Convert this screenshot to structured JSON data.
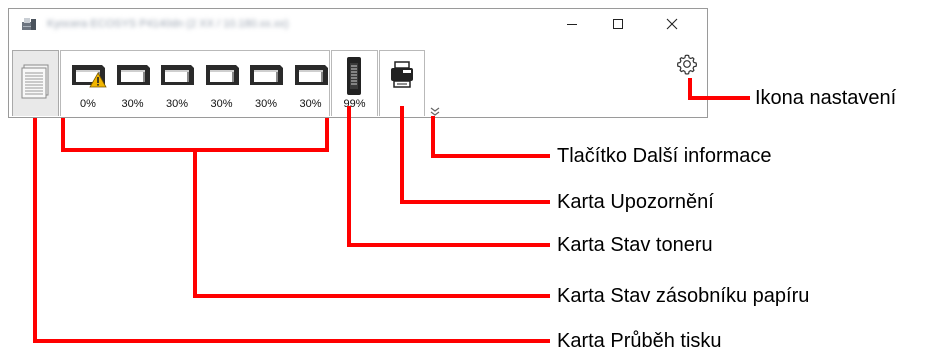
{
  "window": {
    "title": "Kyocera ECOSYS P4140dn (2 XX / 10.180.xx.xx)"
  },
  "tabs": {
    "trays": [
      {
        "percent": "0%",
        "warning": true
      },
      {
        "percent": "30%",
        "warning": false
      },
      {
        "percent": "30%",
        "warning": false
      },
      {
        "percent": "30%",
        "warning": false
      },
      {
        "percent": "30%",
        "warning": false
      },
      {
        "percent": "30%",
        "warning": false
      }
    ],
    "toner": {
      "percent": "99%"
    }
  },
  "icons": {
    "app": "printer-app-icon",
    "print_progress": "paper-stack-icon",
    "tray": "paper-tray-icon",
    "warning": "warning-triangle-icon",
    "toner": "toner-cartridge-icon",
    "alert": "printer-alert-icon",
    "more_info": "double-chevron-down-icon",
    "settings": "gear-icon"
  },
  "callouts": {
    "settings_icon": "Ikona nastavení",
    "more_info_button": "Tlačítko Další informace",
    "alert_tab": "Karta Upozornění",
    "toner_tab": "Karta Stav toneru",
    "tray_tab": "Karta Stav zásobníku papíru",
    "print_progress_tab": "Karta Průběh tisku"
  },
  "colors": {
    "callout_line": "#ff0000",
    "warning": "#f2b600"
  }
}
